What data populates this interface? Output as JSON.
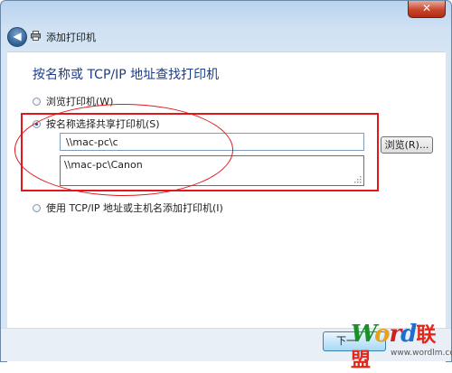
{
  "window": {
    "close_glyph": "✕",
    "back_glyph": "◀",
    "title": "添加打印机"
  },
  "page": {
    "heading": "按名称或 TCP/IP 地址查找打印机",
    "option_browse": "浏览打印机(W)",
    "option_share": "按名称选择共享打印机(S)",
    "option_tcp": "使用 TCP/IP 地址或主机名添加打印机(I)",
    "share_input_value": "\\\\mac-pc\\c",
    "autocomplete_item": "\\\\mac-pc\\Canon",
    "browse_label": "浏览(R)...",
    "selected_option": "share"
  },
  "footer": {
    "next_label": "下一",
    "watermark_word": [
      "W",
      "o",
      "r",
      "d"
    ],
    "watermark_cn": "联盟",
    "watermark_url": "www.wordlm.com"
  },
  "colors": {
    "annotation_red": "#e0181b",
    "heading_blue": "#1a3d8c"
  }
}
